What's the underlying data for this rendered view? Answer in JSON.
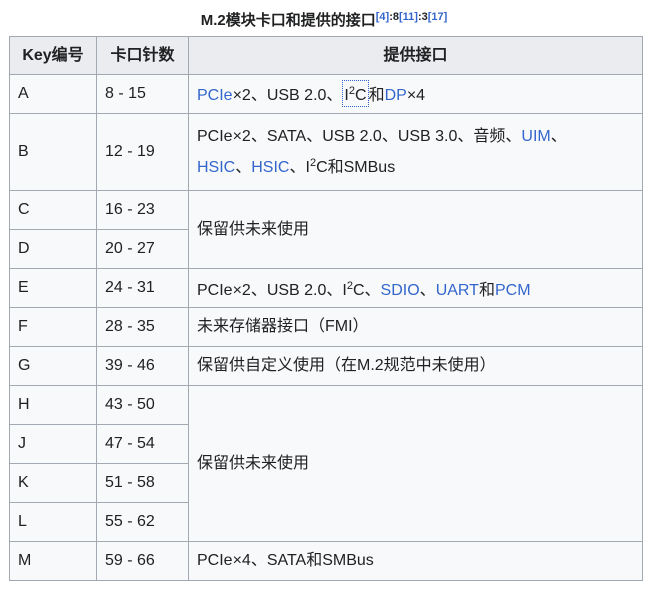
{
  "caption": {
    "title": "M.2模块卡口和提供的接口",
    "ref1": "[4]",
    "p1": ":8",
    "ref2": "[11]",
    "p2": ":3",
    "ref3": "[17]"
  },
  "headers": [
    "Key编号",
    "卡口针数",
    "提供接口"
  ],
  "rows": [
    {
      "key": "A",
      "pins": "8 - 15"
    },
    {
      "key": "B",
      "pins": "12 - 19"
    },
    {
      "key": "C",
      "pins": "16 - 23"
    },
    {
      "key": "D",
      "pins": "20 - 27"
    },
    {
      "key": "E",
      "pins": "24 - 31"
    },
    {
      "key": "F",
      "pins": "28 - 35"
    },
    {
      "key": "G",
      "pins": "39 - 46"
    },
    {
      "key": "H",
      "pins": "43 - 50"
    },
    {
      "key": "J",
      "pins": "47 - 54"
    },
    {
      "key": "K",
      "pins": "51 - 58"
    },
    {
      "key": "L",
      "pins": "55 - 62"
    },
    {
      "key": "M",
      "pins": "59 - 66"
    }
  ],
  "interfaces": {
    "A": {
      "pcie": "PCIe",
      "t1": "×2、USB 2.0、",
      "i2c_i": "I",
      "i2c_2": "2",
      "i2c_c": "C",
      "and": "和",
      "dp": "DP",
      "t2": "×4"
    },
    "B": {
      "t1": "PCIe×2、SATA、USB 2.0、USB 3.0、音频、",
      "uim": "UIM",
      "sep1": "、",
      "hsic1": "HSIC",
      "sep2": "、",
      "hsic2": "HSIC",
      "sep3": "、",
      "i": "I",
      "two": "2",
      "c": "C和SMBus"
    },
    "CD": "保留供未来使用",
    "E": {
      "t1": "PCIe×2、USB 2.0、I",
      "two": "2",
      "t2": "C、",
      "sdio": "SDIO",
      "sep": "、",
      "uart": "UART",
      "and": "和",
      "pcm": "PCM"
    },
    "F": "未来存储器接口（FMI）",
    "G": "保留供自定义使用（在M.2规范中未使用）",
    "HL": "保留供未来使用",
    "M": "PCIe×4、SATA和SMBus"
  },
  "colors": {
    "link": "#3366cc",
    "header_bg": "#eaecf0",
    "cell_bg": "#f8f9fa",
    "border": "#a2a9b1"
  }
}
